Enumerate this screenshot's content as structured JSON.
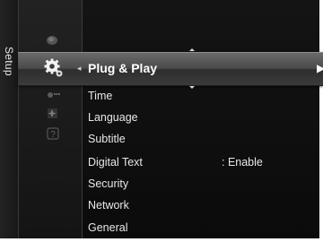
{
  "sidebar": {
    "label": "Setup"
  },
  "selected": {
    "label": "Plug & Play",
    "left_arrow": "◂",
    "right_arrow": "▶"
  },
  "menu": {
    "items": [
      {
        "label": "Time",
        "value": ""
      },
      {
        "label": "Language",
        "value": ""
      },
      {
        "label": "Subtitle",
        "value": ""
      },
      {
        "label": "Digital Text",
        "value": ": Enable"
      },
      {
        "label": "Security",
        "value": ""
      },
      {
        "label": "Network",
        "value": ""
      },
      {
        "label": "General",
        "value": ""
      }
    ]
  },
  "icons": [
    "picture-icon",
    "setup-gear-icon",
    "input-icon",
    "application-icon",
    "support-icon"
  ],
  "colors": {
    "background": "#000000",
    "selection": "#4a4a4a",
    "text": "#e8e8e8"
  }
}
